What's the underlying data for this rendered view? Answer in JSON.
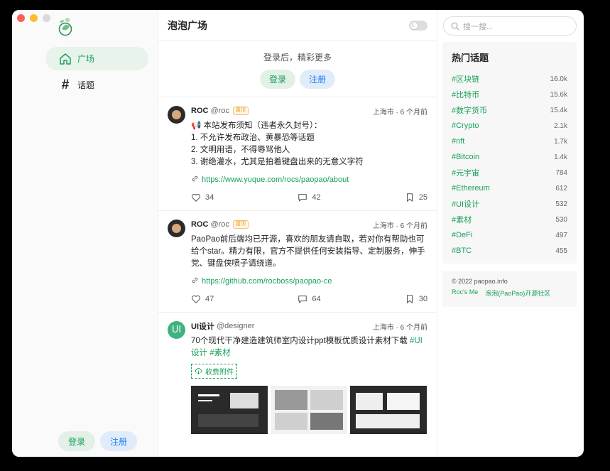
{
  "sidebar": {
    "nav": [
      {
        "label": "广场",
        "icon": "home-icon"
      },
      {
        "label": "话题",
        "icon": "hashtag-icon"
      }
    ],
    "login_label": "登录",
    "register_label": "注册"
  },
  "main": {
    "title": "泡泡广场",
    "login_tip": "登录后，精彩更多",
    "login_label": "登录",
    "register_label": "注册",
    "posts": [
      {
        "name": "ROC",
        "handle": "@roc",
        "badge": "置顶",
        "meta": "上海市 · 6 个月前",
        "lines": [
          "📢 本站发布须知（违者永久封号）：",
          "1. 不允许发布政治、黄暴恐等话题",
          "2. 文明用语，不得辱骂他人",
          "3. 谢绝灌水，尤其是拍着键盘出来的无意义字符"
        ],
        "link": "https://www.yuque.com/rocs/paopao/about",
        "likes": "34",
        "comments": "42",
        "collects": "25"
      },
      {
        "name": "ROC",
        "handle": "@roc",
        "badge": "置顶",
        "meta": "上海市 · 6 个月前",
        "text": "PaoPao前后端均已开源，喜欢的朋友请自取，若对你有帮助也可给个star。精力有限，官方不提供任何安装指导、定制服务，伸手党、键盘侠喷子请绕道。",
        "link": "https://github.com/rocboss/paopao-ce",
        "likes": "47",
        "comments": "64",
        "collects": "30"
      },
      {
        "name": "UI设计",
        "handle": "@designer",
        "meta": "上海市 · 6 个月前",
        "text": "70个现代干净建造建筑师室内设计ppt模板优质设计素材下载",
        "tags": [
          "#UI设计",
          "#素材"
        ],
        "attach_label": "收费附件"
      }
    ]
  },
  "right": {
    "search_placeholder": "搜一搜...",
    "topics_title": "热门话题",
    "topics": [
      {
        "name": "#区块链",
        "count": "16.0k"
      },
      {
        "name": "#比特币",
        "count": "15.6k"
      },
      {
        "name": "#数字货币",
        "count": "15.4k"
      },
      {
        "name": "#Crypto",
        "count": "2.1k"
      },
      {
        "name": "#nft",
        "count": "1.7k"
      },
      {
        "name": "#Bitcoin",
        "count": "1.4k"
      },
      {
        "name": "#元宇宙",
        "count": "784"
      },
      {
        "name": "#Ethereum",
        "count": "612"
      },
      {
        "name": "#UI设计",
        "count": "532"
      },
      {
        "name": "#素材",
        "count": "530"
      },
      {
        "name": "#DeFi",
        "count": "497"
      },
      {
        "name": "#BTC",
        "count": "455"
      }
    ],
    "copyright": "© 2022 paopao.info",
    "links": [
      "Roc's Me",
      "泡泡(PaoPao)开源社区"
    ]
  },
  "colors": {
    "accent": "#18a058",
    "blue": "#2080f0",
    "badge": "#f0a020"
  }
}
